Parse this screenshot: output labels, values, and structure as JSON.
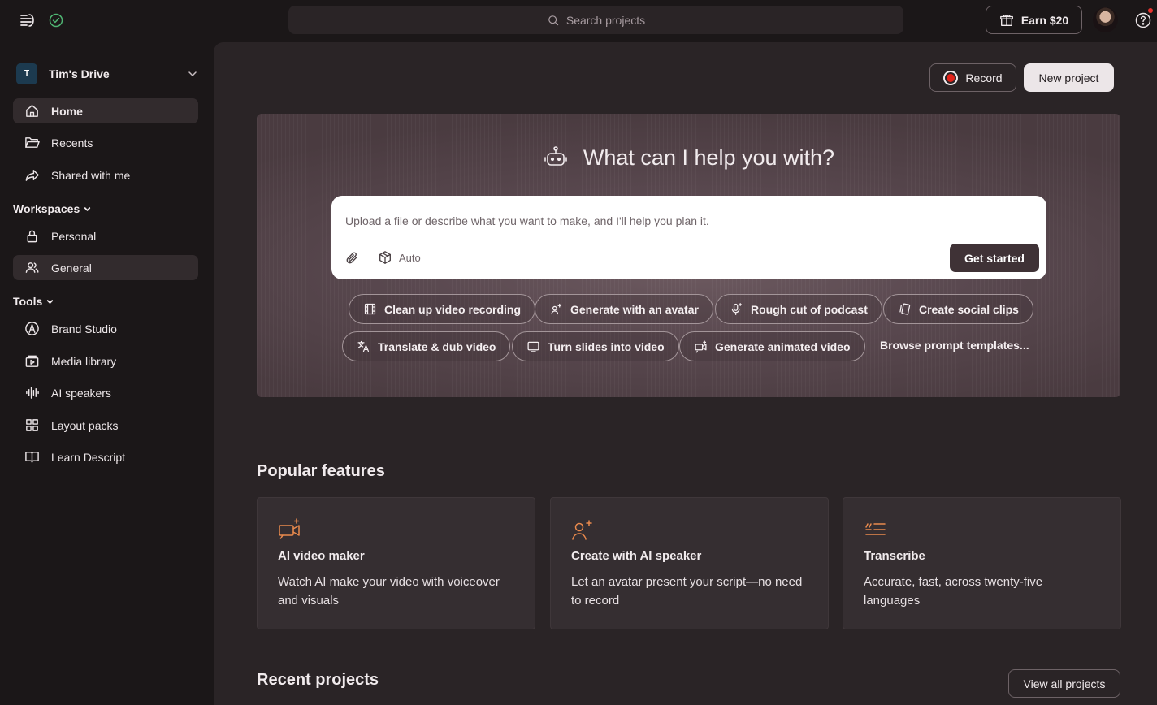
{
  "topbar": {
    "search_placeholder": "Search projects",
    "earn_label": "Earn $20"
  },
  "sidebar": {
    "drive_initial": "T",
    "drive_name": "Tim's Drive",
    "nav": [
      {
        "label": "Home",
        "icon": "home-icon",
        "active": true
      },
      {
        "label": "Recents",
        "icon": "folder-icon"
      },
      {
        "label": "Shared with me",
        "icon": "share-icon"
      }
    ],
    "workspaces_label": "Workspaces",
    "workspaces": [
      {
        "label": "Personal",
        "icon": "lock-icon"
      },
      {
        "label": "General",
        "icon": "users-icon",
        "active": true
      }
    ],
    "tools_label": "Tools",
    "tools": [
      {
        "label": "Brand Studio",
        "icon": "brand-icon"
      },
      {
        "label": "Media library",
        "icon": "media-library-icon"
      },
      {
        "label": "AI speakers",
        "icon": "waveform-icon"
      },
      {
        "label": "Layout packs",
        "icon": "grid-icon"
      },
      {
        "label": "Learn Descript",
        "icon": "book-icon"
      }
    ]
  },
  "header": {
    "record_label": "Record",
    "new_project_label": "New project"
  },
  "hero": {
    "title": "What can I help you with?",
    "prompt_placeholder": "Upload a file or describe what you want to make, and I'll help you plan it.",
    "mode_label": "Auto",
    "get_started_label": "Get started",
    "chips": [
      {
        "label": "Clean up video recording",
        "icon": "film-icon"
      },
      {
        "label": "Generate with an avatar",
        "icon": "avatar-sparkle-icon"
      },
      {
        "label": "Rough cut of podcast",
        "icon": "microphone-sparkle-icon"
      },
      {
        "label": "Create social clips",
        "icon": "phone-clips-icon"
      },
      {
        "label": "Translate & dub video",
        "icon": "translate-icon"
      },
      {
        "label": "Turn slides into video",
        "icon": "slides-icon"
      },
      {
        "label": "Generate animated video",
        "icon": "video-sparkle-icon"
      }
    ],
    "browse_label": "Browse prompt templates..."
  },
  "popular": {
    "heading": "Popular features",
    "cards": [
      {
        "title": "AI video maker",
        "desc": "Watch AI make your video with voiceover and visuals",
        "icon": "video-camera-sparkle-icon"
      },
      {
        "title": "Create with AI speaker",
        "desc": "Let an avatar present your script—no need to record",
        "icon": "person-sparkle-icon"
      },
      {
        "title": "Transcribe",
        "desc": "Accurate, fast, across twenty-five languages",
        "icon": "quote-lines-icon"
      }
    ]
  },
  "recent": {
    "heading": "Recent projects",
    "view_all_label": "View all projects"
  },
  "colors": {
    "background": "#1b1718",
    "panel": "#2a2426",
    "card": "#352e31",
    "accent_orange": "#ea8a4d",
    "record_red": "#e2231a",
    "sync_green": "#4fb472"
  }
}
